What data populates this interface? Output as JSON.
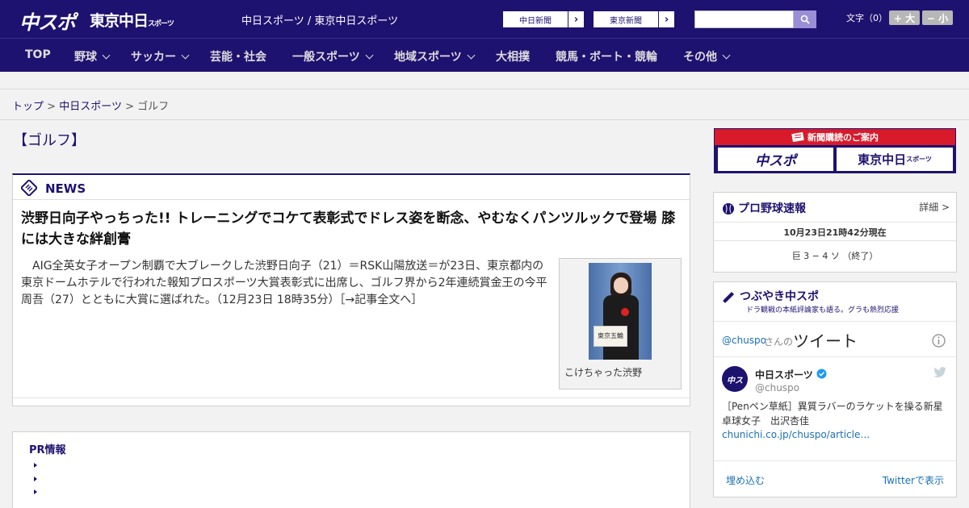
{
  "header": {
    "logo_main": "中スポ",
    "logo_tokyo": "東京中日",
    "logo_tokyo_small": "スポーツ",
    "site_links": "中日スポーツ / 東京中日スポーツ",
    "ext_links": [
      {
        "label": "中日新聞"
      },
      {
        "label": "東京新聞"
      }
    ],
    "search_placeholder": "",
    "font_size_label": "文字（0）",
    "font_larger": "+ 大",
    "font_smaller": "− 小"
  },
  "nav": {
    "items": [
      {
        "label": "TOP"
      },
      {
        "label": "野球"
      },
      {
        "label": "サッカー"
      },
      {
        "label": "芸能・社会"
      },
      {
        "label": "一般スポーツ"
      },
      {
        "label": "地域スポーツ"
      },
      {
        "label": "大相撲"
      },
      {
        "label": "競馬・ボート・競輪"
      },
      {
        "label": "その他"
      }
    ]
  },
  "breadcrumb": {
    "top": "トップ",
    "sep": ">",
    "section": "中日スポーツ",
    "current": "ゴルフ"
  },
  "page_title": "【ゴルフ】",
  "news": {
    "label": "NEWS",
    "headline": "渋野日向子やっちった!! トレーニングでコケて表彰式でドレス姿を断念、やむなくパンツルックで登場 膝には大きな絆創膏",
    "lead": "AIG全英女子オープン制覇で大ブレークした渋野日向子（21）＝RSK山陽放送＝が23日、東京都内の東京ドームホテルで行われた報知プロスポーツ大賞表彰式に出席し、ゴルフ界から2年連続賞金王の今平周吾（27）とともに大賞に選ばれた。（12月23日 18時35分）［→記事全文へ］",
    "photo_caption": "こけちゃった渋野",
    "photo_board_text": "東京五輪"
  },
  "pr": {
    "title": "PR情報"
  },
  "sidebar": {
    "subscribe_title": "新聞購読のご案内",
    "subscribe_btn1": "中スポ",
    "subscribe_btn2": "東京中日",
    "subscribe_btn2_small": "スポーツ",
    "baseball": {
      "title": "プロ野球速報",
      "detail": "詳細 >",
      "timestamp": "10月23日21時42分現在",
      "score": "巨 3 − 4 ソ （終了）"
    },
    "tweets": {
      "title": "つぶやき中スポ",
      "subtitle": "ドラ観戦の本紙評論家も語る。グラも熱烈応援",
      "account": "@chuspo",
      "account_suffix": "さんの",
      "tweet_label": "ツイート",
      "user_name": "中日スポーツ",
      "user_handle": "@chuspo",
      "tweet_text": "［Penペン草紙］異質ラバーのラケットを操る新星　卓球女子　出沢杏佳",
      "tweet_link": "chunichi.co.jp/chuspo/article…",
      "embed": "埋め込む",
      "view_on": "Twitterで表示"
    }
  }
}
